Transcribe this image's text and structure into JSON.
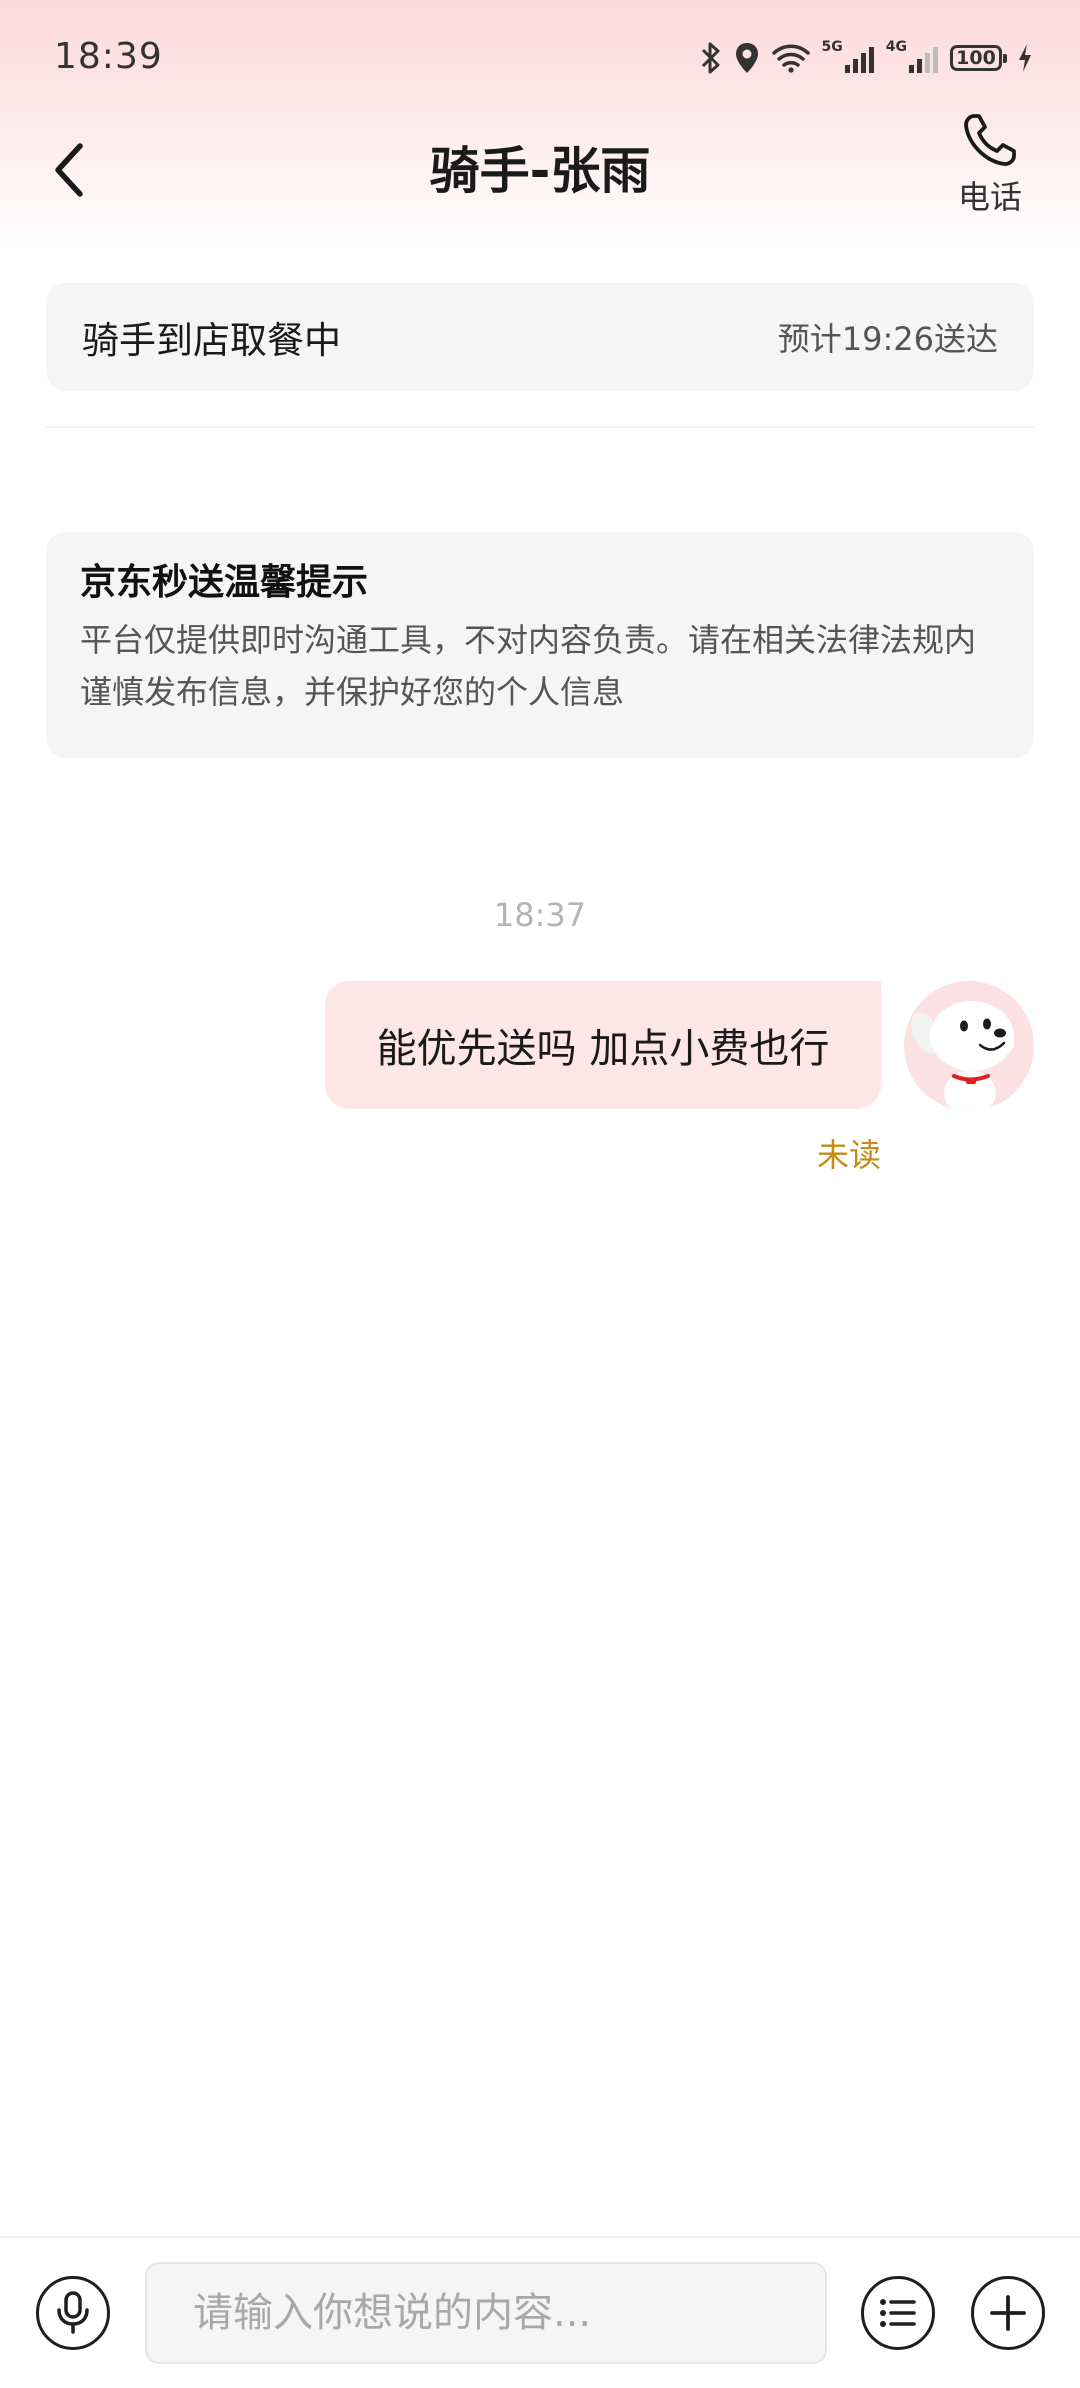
{
  "status_bar": {
    "time": "18:39",
    "network_5g": "5G",
    "network_4g": "4G",
    "battery": "100",
    "icons": [
      "bluetooth-icon",
      "location-icon",
      "wifi-icon",
      "signal-icon",
      "battery-icon",
      "charging-icon"
    ]
  },
  "header": {
    "title": "骑手-张雨",
    "phone_label": "电话",
    "icons": [
      "back-chevron-icon",
      "phone-icon"
    ]
  },
  "order_status": {
    "state": "骑手到店取餐中",
    "eta": "预计19:26送达"
  },
  "notice": {
    "title": "京东秒送温馨提示",
    "body": "平台仅提供即时沟通工具，不对内容负责。请在相关法律法规内谨慎发布信息，并保护好您的个人信息"
  },
  "chat": {
    "timestamp": "18:37",
    "messages": [
      {
        "text": "能优先送吗 加点小费也行",
        "status": "未读",
        "from": "me"
      }
    ]
  },
  "input_bar": {
    "placeholder": "请输入你想说的内容...",
    "icons": [
      "microphone-icon",
      "list-icon",
      "plus-icon"
    ]
  },
  "colors": {
    "header_gradient_top": "#fcd9dc",
    "bubble": "#fde6e6",
    "unread": "#c58b15",
    "card": "#f5f5f5"
  }
}
